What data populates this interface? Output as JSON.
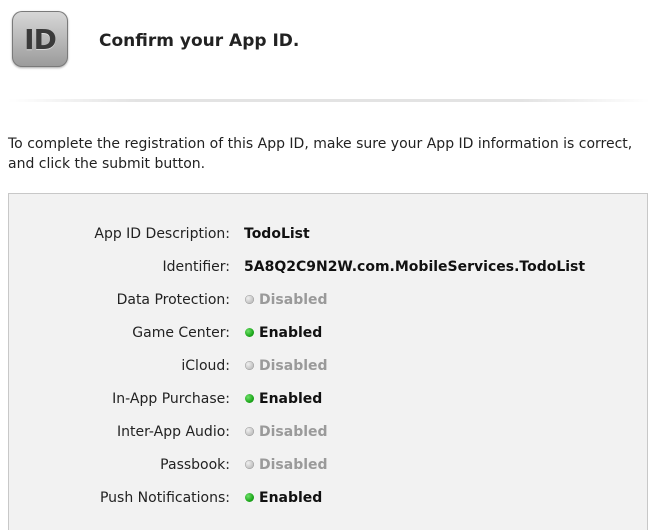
{
  "header": {
    "icon_text": "ID",
    "title": "Confirm your App ID."
  },
  "intro": "To complete the registration of this App ID, make sure your App ID information is correct, and click the submit button.",
  "details": {
    "description": {
      "label": "App ID Description:",
      "value": "TodoList"
    },
    "identifier": {
      "label": "Identifier:",
      "value": "5A8Q2C9N2W.com.MobileServices.TodoList"
    }
  },
  "services": [
    {
      "label": "Data Protection:",
      "status": "Disabled",
      "enabled": false
    },
    {
      "label": "Game Center:",
      "status": "Enabled",
      "enabled": true
    },
    {
      "label": "iCloud:",
      "status": "Disabled",
      "enabled": false
    },
    {
      "label": "In-App Purchase:",
      "status": "Enabled",
      "enabled": true
    },
    {
      "label": "Inter-App Audio:",
      "status": "Disabled",
      "enabled": false
    },
    {
      "label": "Passbook:",
      "status": "Disabled",
      "enabled": false
    },
    {
      "label": "Push Notifications:",
      "status": "Enabled",
      "enabled": true
    }
  ],
  "colors": {
    "enabled_dot": "#1ea81c",
    "disabled_dot": "#c4c4c4",
    "disabled_text": "#9a9a9a"
  }
}
